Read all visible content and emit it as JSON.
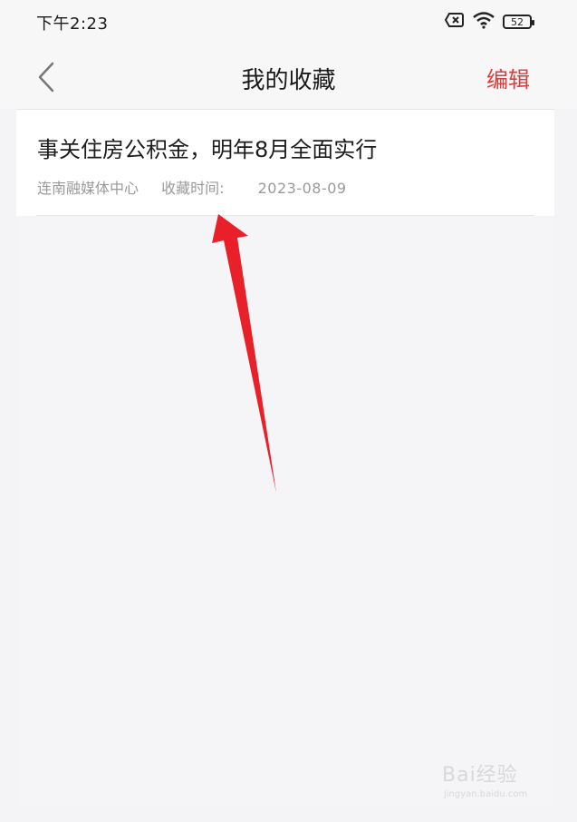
{
  "status": {
    "time": "下午2:23",
    "battery": "52",
    "icons": [
      "sim-x-icon",
      "wifi-icon",
      "battery-icon"
    ]
  },
  "nav": {
    "title": "我的收藏",
    "edit_label": "编辑",
    "back_icon": "chevron-left-icon"
  },
  "favorites": [
    {
      "title": "事关住房公积金，明年8月全面实行",
      "source": "连南融媒体中心",
      "time_label": "收藏时间:",
      "date": "2023-08-09"
    }
  ],
  "watermark": {
    "text": "Bai经验",
    "sub": "jingyan.baidu.com"
  },
  "colors": {
    "accent": "#e33a3a",
    "annotation_arrow": "#e8202a"
  }
}
